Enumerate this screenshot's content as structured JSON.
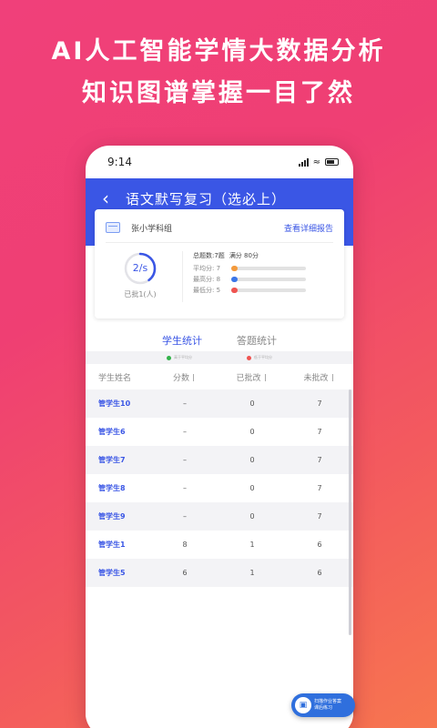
{
  "promo": {
    "line1": "AI人工智能学情大数据分析",
    "line2": "知识图谱掌握一目了然"
  },
  "status_bar": {
    "time": "9:14"
  },
  "app_bar": {
    "title": "语文默写复习（选必上）"
  },
  "summary": {
    "group_name": "张小学科组",
    "detail_link": "查看详细报告",
    "ring_value": "2/s",
    "ring_label": "已批1(人)",
    "total_label": "总题数:7题",
    "full_label": "满分 80分",
    "rows": [
      {
        "label": "平均分: 7",
        "color": "#f39a3c"
      },
      {
        "label": "最高分: 8",
        "color": "#3a76e8"
      },
      {
        "label": "最低分: 5",
        "color": "#ef5350"
      }
    ]
  },
  "tabs": [
    {
      "label": "学生统计",
      "active": true
    },
    {
      "label": "答题统计",
      "active": false
    }
  ],
  "legend": [
    {
      "label": "高于平均分",
      "color": "#33b24a"
    },
    {
      "label": "低于平均分",
      "color": "#ef5350"
    }
  ],
  "table": {
    "headers": {
      "name": "学生姓名",
      "score": "分数",
      "graded": "已批改",
      "ungraded": "未批改"
    },
    "rows": [
      {
        "name": "管学生10",
        "score": "–",
        "graded": "0",
        "ungraded": "7"
      },
      {
        "name": "管学生6",
        "score": "–",
        "graded": "0",
        "ungraded": "7"
      },
      {
        "name": "管学生7",
        "score": "–",
        "graded": "0",
        "ungraded": "7"
      },
      {
        "name": "管学生8",
        "score": "–",
        "graded": "0",
        "ungraded": "7"
      },
      {
        "name": "管学生9",
        "score": "–",
        "graded": "0",
        "ungraded": "7"
      },
      {
        "name": "管学生1",
        "score": "8",
        "graded": "1",
        "ungraded": "6"
      },
      {
        "name": "管学生5",
        "score": "6",
        "graded": "1",
        "ungraded": "6"
      }
    ]
  },
  "float_button": {
    "line1": "扫描作业答案",
    "line2": "课后练习"
  },
  "colors": {
    "primary": "#3a56e5",
    "background_pink": "#ef3f73",
    "background_orange": "#f7764f"
  }
}
